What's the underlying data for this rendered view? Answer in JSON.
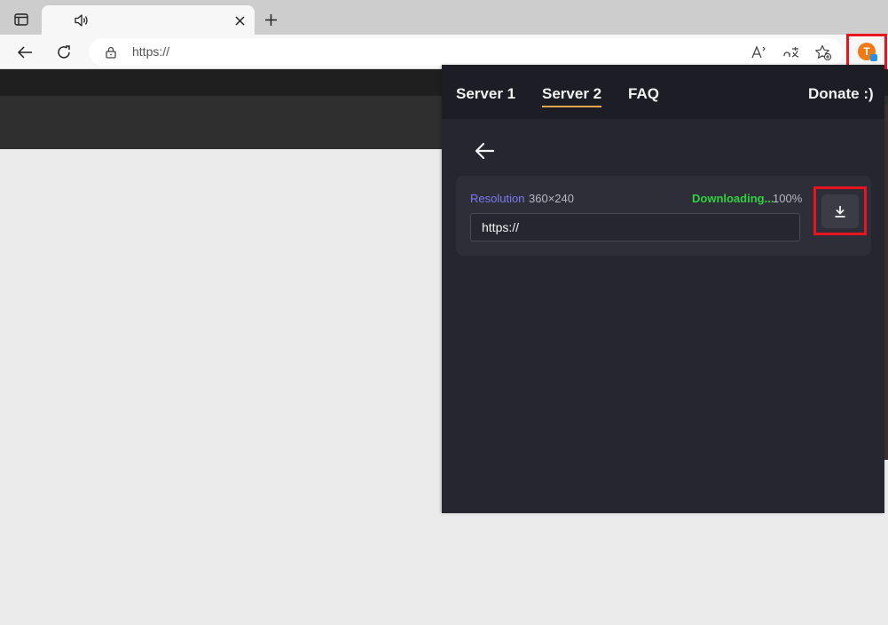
{
  "browser": {
    "address_bar": {
      "url": "https://"
    },
    "tab": {
      "audio_icon": "speaker-icon",
      "close_icon": "close-icon"
    },
    "icons": {
      "tab_actions": "tab-actions-icon",
      "new_tab": "plus-icon",
      "back": "back-arrow-icon",
      "refresh": "refresh-icon",
      "lock": "lock-icon",
      "read_aloud": "read-aloud-icon",
      "translate": "translate-icon",
      "favorites": "add-favorite-icon",
      "extension": "extension-logo-icon"
    }
  },
  "popup": {
    "nav": {
      "server1": "Server 1",
      "server2": "Server 2",
      "faq": "FAQ",
      "donate": "Donate :)",
      "active": "server2"
    },
    "back_icon": "back-arrow-icon",
    "download_item": {
      "resolution_label": "Resolution",
      "resolution_value": "360×240",
      "status": "Downloading...",
      "progress": "100%",
      "url": "https://",
      "download_icon": "download-icon"
    }
  },
  "colors": {
    "popup_bg": "#262630",
    "nav_bg": "#1d1d25",
    "accent_underline": "#f0a64a",
    "resolution_label": "#7b7bf0",
    "status_green": "#2fd13f",
    "highlight_red": "#e8141e"
  }
}
